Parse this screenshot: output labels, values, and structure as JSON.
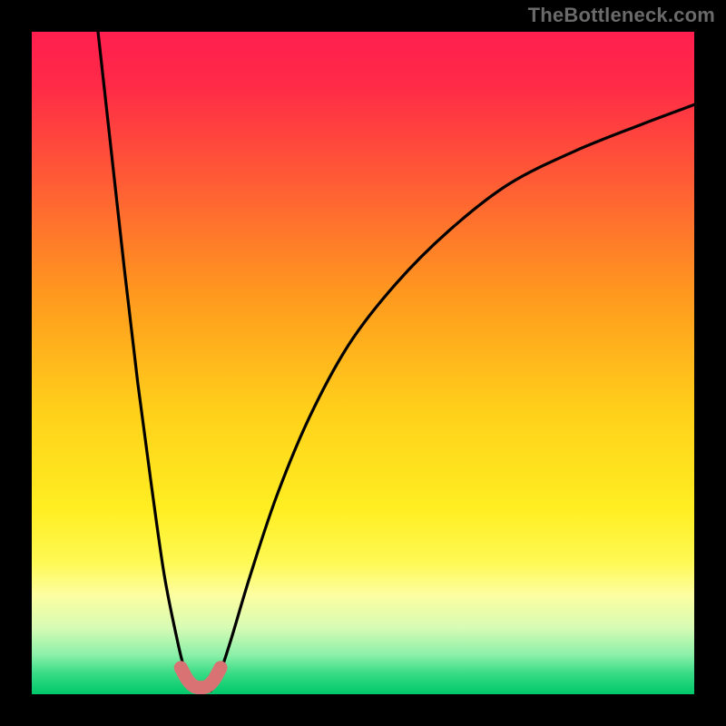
{
  "attribution": "TheBottleneck.com",
  "chart_data": {
    "type": "line",
    "title": "",
    "xlabel": "",
    "ylabel": "",
    "xlim": [
      0,
      100
    ],
    "ylim": [
      0,
      100
    ],
    "series": [
      {
        "name": "left-curve",
        "x": [
          10,
          12,
          14,
          16,
          18,
          20,
          22,
          23,
          24,
          25,
          26
        ],
        "y": [
          100,
          82,
          64,
          47,
          32,
          18,
          8,
          4,
          2,
          1,
          0.5
        ]
      },
      {
        "name": "right-curve",
        "x": [
          27,
          28,
          30,
          33,
          37,
          42,
          48,
          55,
          63,
          72,
          82,
          92,
          100
        ],
        "y": [
          0.5,
          2,
          8,
          18,
          30,
          42,
          53,
          62,
          70,
          77,
          82,
          86,
          89
        ]
      },
      {
        "name": "bottom-marker",
        "x": [
          22.5,
          23.5,
          24.5,
          25.5,
          26.5,
          27.5,
          28.5
        ],
        "y": [
          4.0,
          2.2,
          1.2,
          1.0,
          1.2,
          2.2,
          4.0
        ]
      }
    ],
    "gradient_stops": [
      {
        "pct": 0,
        "color": "#ff1f4f"
      },
      {
        "pct": 8,
        "color": "#ff2a47"
      },
      {
        "pct": 22,
        "color": "#ff5a36"
      },
      {
        "pct": 40,
        "color": "#ff9a1e"
      },
      {
        "pct": 58,
        "color": "#ffd21a"
      },
      {
        "pct": 72,
        "color": "#ffee22"
      },
      {
        "pct": 80,
        "color": "#fef953"
      },
      {
        "pct": 85,
        "color": "#fdfea0"
      },
      {
        "pct": 90,
        "color": "#d6fbb4"
      },
      {
        "pct": 94,
        "color": "#8cf0a9"
      },
      {
        "pct": 97,
        "color": "#35db84"
      },
      {
        "pct": 100,
        "color": "#00c86a"
      }
    ],
    "marker_color": "#d97273",
    "curve_color": "#000000"
  }
}
